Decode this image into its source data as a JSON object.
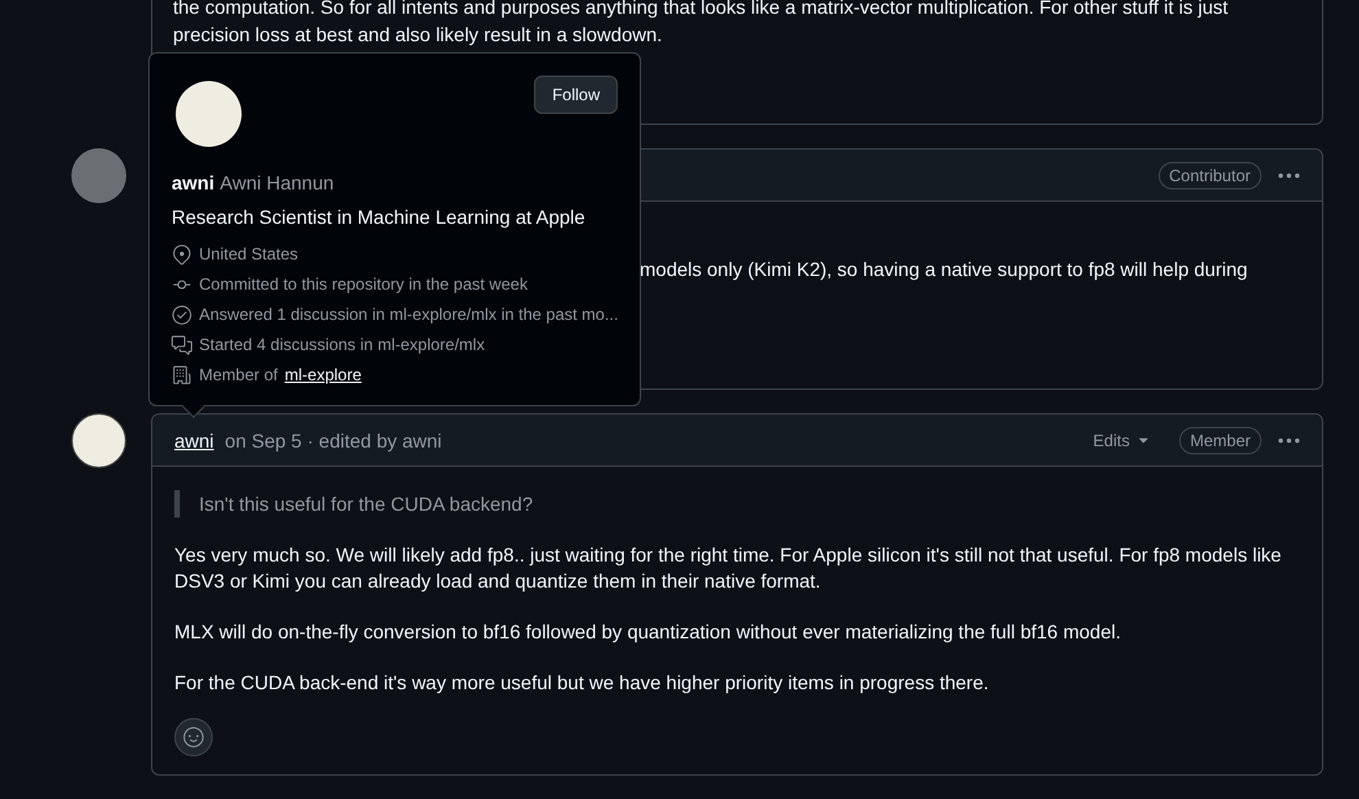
{
  "comments": [
    {
      "body": [
        "the computation. So for all intents and purposes anything that looks like a matrix-vector multiplication. For other stuff it is just precision loss at best and also likely result in a slowdown."
      ]
    },
    {
      "header": {
        "badge": "Contributor"
      },
      "body": [
        "models only (Kimi K2), so having a native support to fp8 will help during"
      ]
    },
    {
      "header": {
        "author": "awni",
        "meta": "on Sep 5 · edited by awni",
        "edits": "Edits",
        "badge": "Member"
      },
      "quote": "Isn't this useful for the CUDA backend?",
      "body": [
        "Yes very much so. We will likely add fp8.. just waiting for the right time. For Apple silicon it's still not that useful. For fp8 models like DSV3 or Kimi you can already load and quantize them in their native format.",
        "MLX will do on-the-fly conversion to bf16 followed by quantization without ever materializing the full bf16 model.",
        "For the CUDA back-end it's way more useful but we have higher priority items in progress there."
      ]
    }
  ],
  "hovercard": {
    "follow": "Follow",
    "login": "awni",
    "name": "Awni Hannun",
    "bio": "Research Scientist in Machine Learning at Apple",
    "details": [
      {
        "kind": "location",
        "text": "United States"
      },
      {
        "kind": "commit",
        "text": "Committed to this repository in the past week"
      },
      {
        "kind": "answered",
        "text": "Answered 1 discussion in ml-explore/mlx in the past mo..."
      },
      {
        "kind": "discussion",
        "text": "Started 4 discussions in ml-explore/mlx"
      },
      {
        "kind": "org",
        "text": "Member of",
        "link": "ml-explore"
      }
    ]
  }
}
